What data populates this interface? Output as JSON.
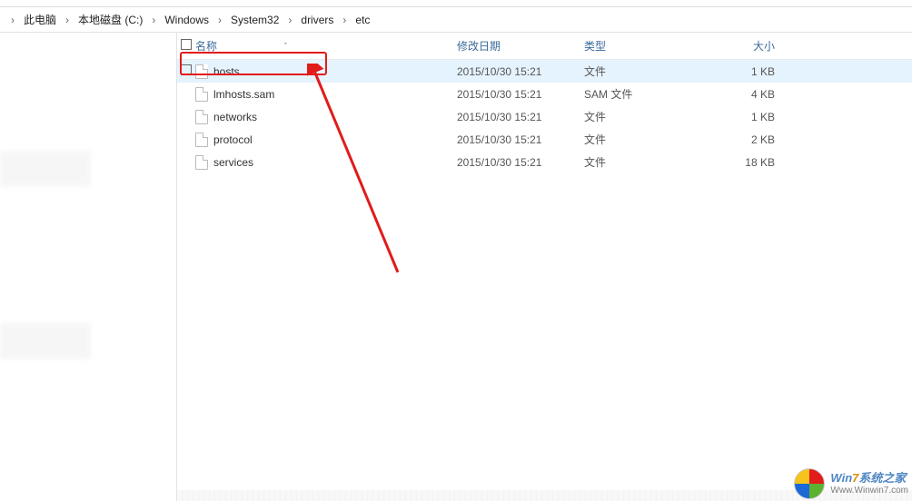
{
  "breadcrumb": {
    "segments": [
      "此电脑",
      "本地磁盘 (C:)",
      "Windows",
      "System32",
      "drivers",
      "etc"
    ]
  },
  "columns": {
    "name": "名称",
    "date": "修改日期",
    "type": "类型",
    "size": "大小"
  },
  "files": [
    {
      "name": "hosts",
      "date": "2015/10/30 15:21",
      "type": "文件",
      "size": "1 KB",
      "selected": true
    },
    {
      "name": "lmhosts.sam",
      "date": "2015/10/30 15:21",
      "type": "SAM 文件",
      "size": "4 KB",
      "selected": false
    },
    {
      "name": "networks",
      "date": "2015/10/30 15:21",
      "type": "文件",
      "size": "1 KB",
      "selected": false
    },
    {
      "name": "protocol",
      "date": "2015/10/30 15:21",
      "type": "文件",
      "size": "2 KB",
      "selected": false
    },
    {
      "name": "services",
      "date": "2015/10/30 15:21",
      "type": "文件",
      "size": "18 KB",
      "selected": false
    }
  ],
  "watermark": {
    "line1_a": "Win",
    "line1_b": "7",
    "line1_c": "系统之家",
    "line2": "Www.Winwin7.com"
  }
}
